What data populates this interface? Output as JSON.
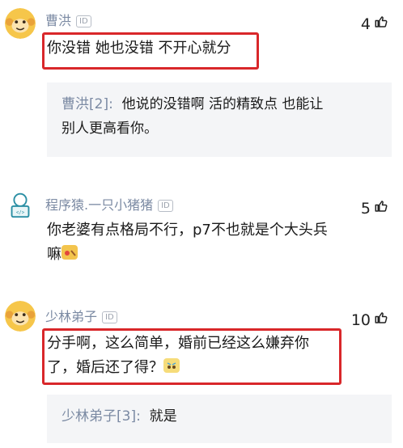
{
  "comments": [
    {
      "username": "曹洪",
      "id_badge": "ID",
      "likes": "4",
      "text": "你没错 她也没错 不开心就分",
      "reply": {
        "author": "曹洪[2]:",
        "text_line1": "他说的没错啊  活的精致点 也能让",
        "text_line2": "别人更高看你。"
      }
    },
    {
      "username": "程序猿.一只小猪猪",
      "id_badge": "ID",
      "likes": "5",
      "text_line1": "你老婆有点格局不行，p7不也就是个大头兵",
      "text_line2": "嘛"
    },
    {
      "username": "少林弟子",
      "id_badge": "ID",
      "likes": "10",
      "text_line1": "分手啊，这么简单，婚前已经这么嫌弃你",
      "text_line2": "了，婚后还了得？",
      "reply": {
        "author": "少林弟子[3]:",
        "text": "就是"
      }
    }
  ],
  "colors": {
    "highlight_box": "#d9272a",
    "username": "#7b8aa3",
    "reply_bg": "#f4f5f7"
  },
  "icons": {
    "like": "thumbs-up-icon",
    "monkey_avatar": "monkey-avatar-icon",
    "coder_avatar": "coder-avatar-icon",
    "emoji": "emoji-icon"
  }
}
